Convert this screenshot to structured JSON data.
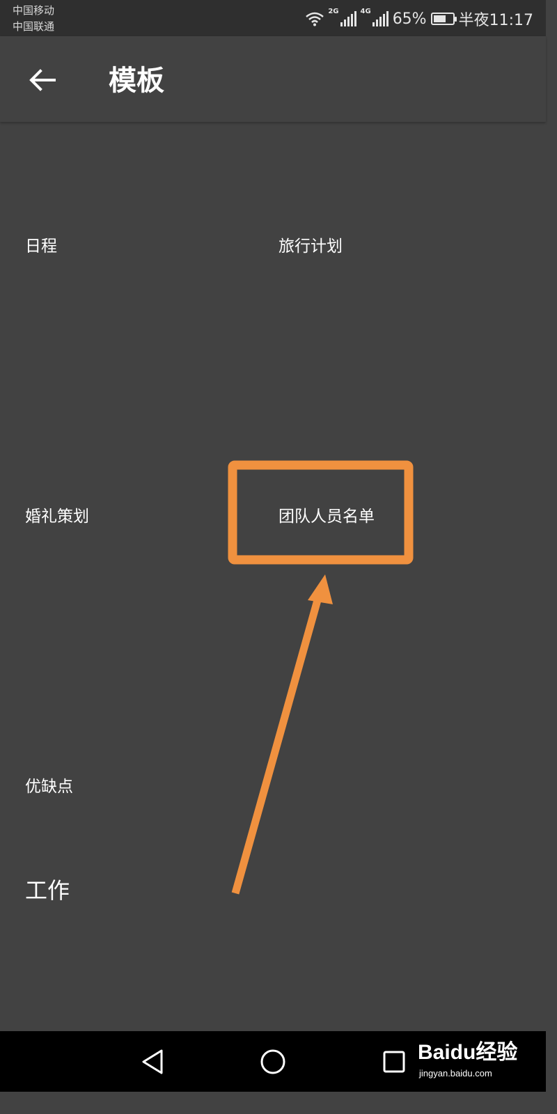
{
  "status_bar": {
    "carrier_1": "中国移动",
    "carrier_2": "中国联通",
    "network_1": "2G",
    "network_2": "4G",
    "battery_percent": "65%",
    "battery_level": 0.65,
    "time": "半夜11:17",
    "icons": [
      "wifi-icon",
      "signal-icon",
      "battery-icon"
    ]
  },
  "app_bar": {
    "back_icon": "arrow-left-icon",
    "title": "模板"
  },
  "templates": [
    {
      "label": "日程"
    },
    {
      "label": "旅行计划"
    },
    {
      "label": "婚礼策划"
    },
    {
      "label": "团队人员名单"
    },
    {
      "label": "优缺点"
    },
    {
      "label": "工作"
    }
  ],
  "annotation": {
    "color": "#F0913F",
    "highlighted_item": "团队人员名单"
  },
  "nav_bar": {
    "icons": [
      "triangle-back-icon",
      "circle-home-icon",
      "square-recents-icon"
    ]
  },
  "watermark": {
    "brand": "Baidu经验",
    "url": "jingyan.baidu.com"
  },
  "colors": {
    "background": "#424242",
    "status_bar": "#2F2F2F",
    "nav_bar": "#000000",
    "text": "#FFFFFF"
  }
}
